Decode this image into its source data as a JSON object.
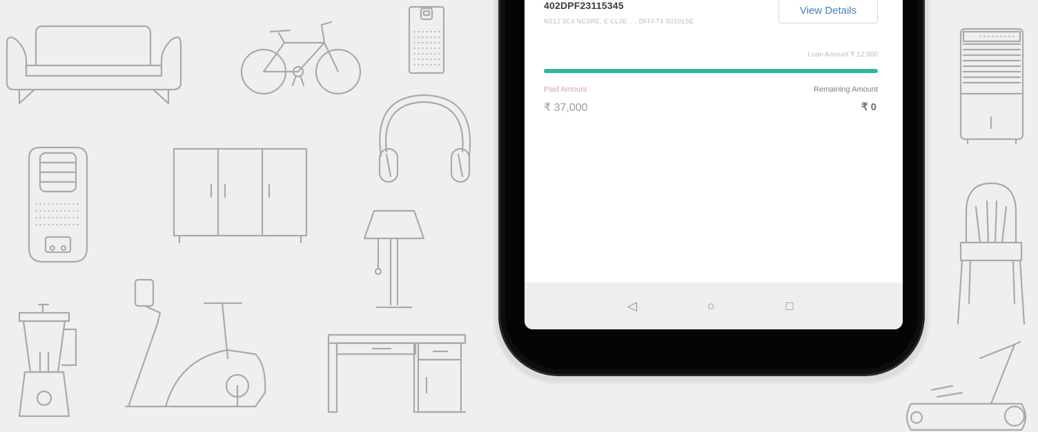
{
  "order": {
    "id": "402DPF23115345",
    "subtitle": "NS12 3C4 NCSRE, E CL3E... , DFFFT4 S0101SE"
  },
  "view_details_label": "View Details",
  "loan": {
    "label": "Loan Amount ₹ 12,000",
    "progress_percent": 100,
    "paid_label": "Paid Amount",
    "paid_value": "₹ 37,000",
    "remaining_label": "Remaining Amount",
    "remaining_value": "₹ 0"
  },
  "colors": {
    "background": "#efefef",
    "progress": "#2fb79b",
    "accent": "#4a7fb5",
    "outline": "#a9a9a9"
  },
  "nav": {
    "back_icon": "◁",
    "home_icon": "○",
    "recents_icon": "□"
  },
  "background_icons": [
    "sofa-icon",
    "bicycle-icon",
    "air-purifier-icon",
    "headphones-icon",
    "air-cooler-icon",
    "wardrobe-icon",
    "floor-lamp-icon",
    "blender-icon",
    "exercise-bike-icon",
    "desk-icon",
    "tower-cooler-icon",
    "chair-icon",
    "treadmill-icon"
  ]
}
